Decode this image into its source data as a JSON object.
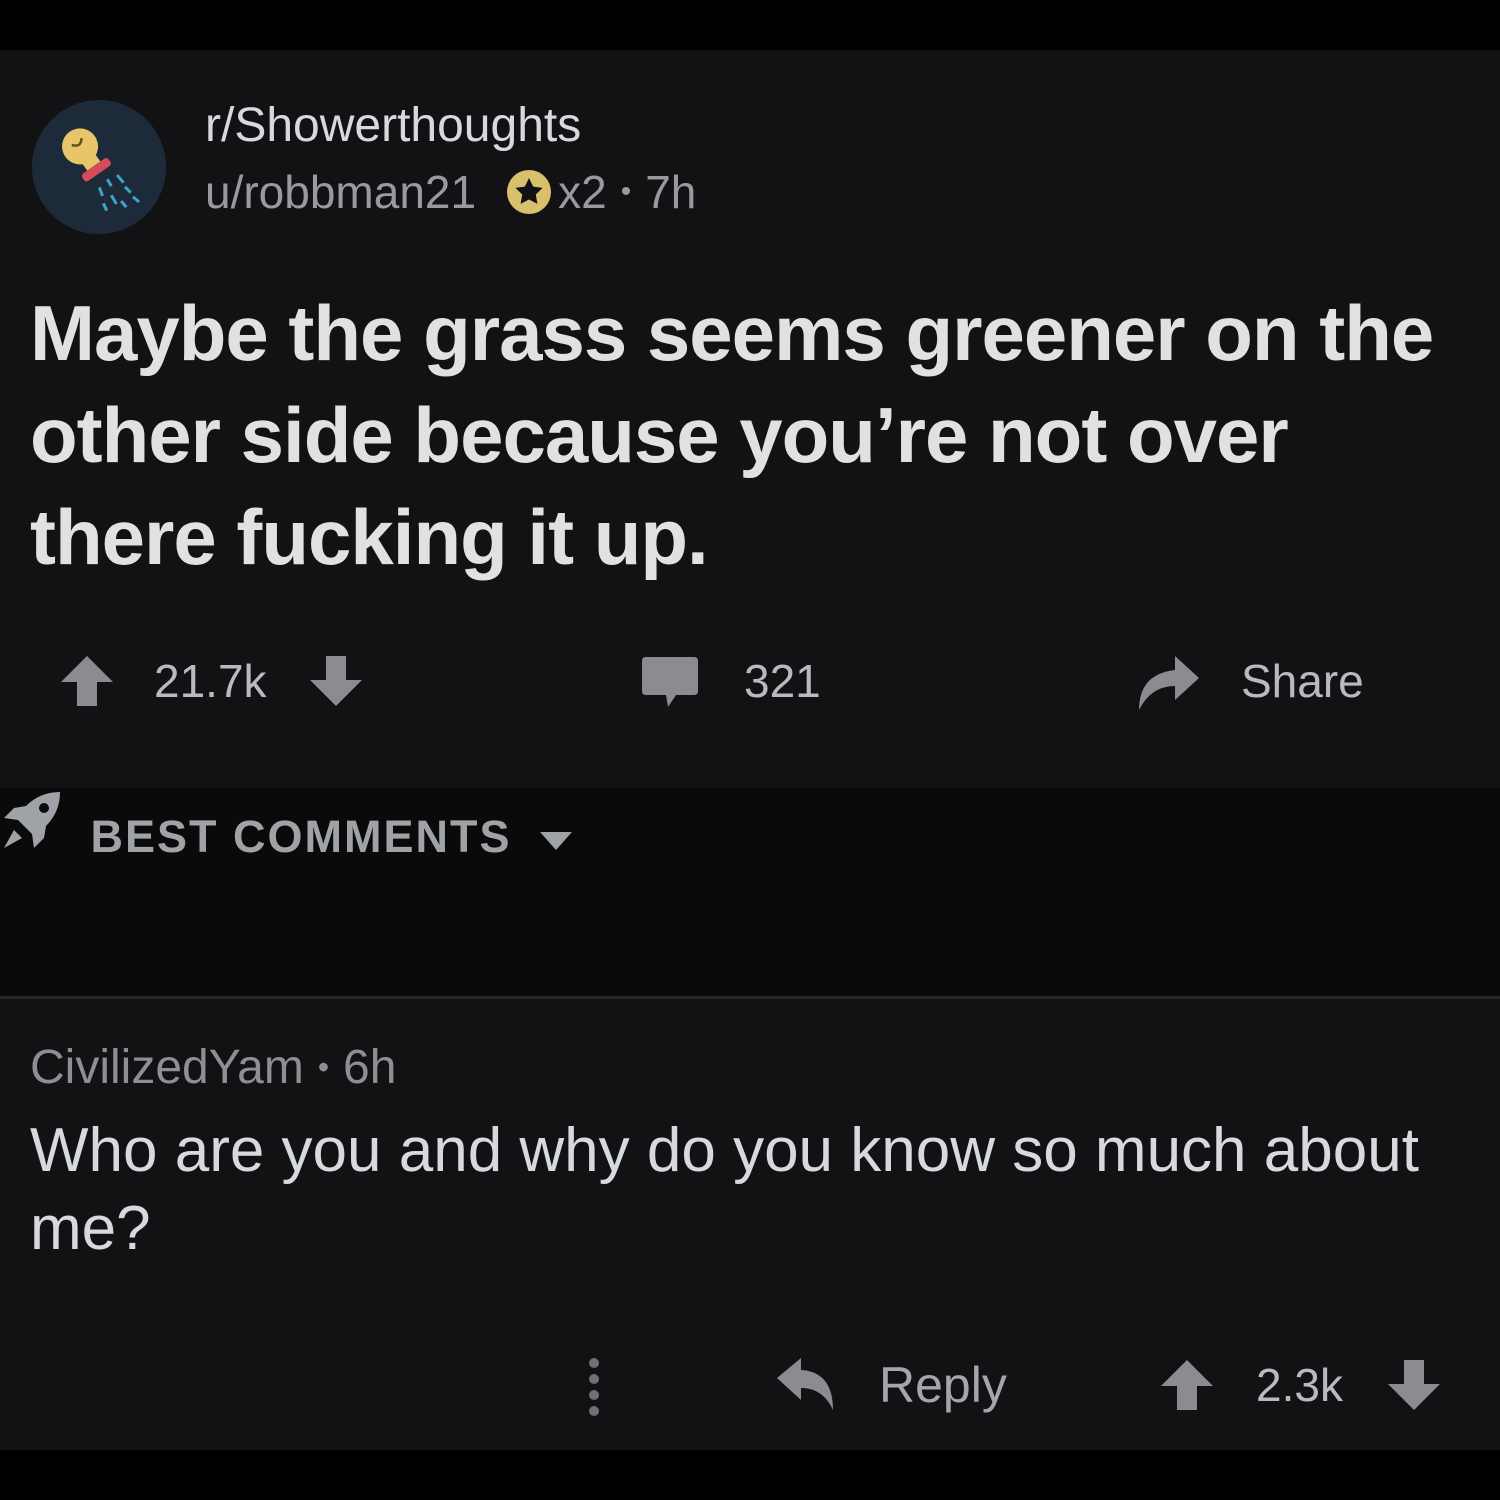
{
  "post": {
    "subreddit": "r/Showerthoughts",
    "author": "u/robbman21",
    "award_count": "x2",
    "time": "7h",
    "title": "Maybe the grass seems greener on the other side because you’re not over there fucking it up.",
    "score": "21.7k",
    "comment_count": "321",
    "share_label": "Share"
  },
  "sort": {
    "label": "BEST COMMENTS"
  },
  "comment": {
    "author": "CivilizedYam",
    "time": "6h",
    "body": "Who are you and why do you know so much about me?",
    "reply_label": "Reply",
    "score": "2.3k"
  },
  "colors": {
    "background": "#121214",
    "sort_bar": "#0a0a0b",
    "text_primary": "#d7dadc",
    "text_meta": "#9a9a9e",
    "award_gold": "#d8c16a"
  },
  "icons": {
    "avatar": "shower-lightbulb-icon",
    "award": "silver-star-award-icon",
    "upvote": "arrow-up-icon",
    "downvote": "arrow-down-icon",
    "comments": "speech-bubble-icon",
    "share": "share-arrow-icon",
    "sort": "rocket-icon",
    "caret": "caret-down-icon",
    "more": "vertical-dots-icon",
    "reply": "reply-arrow-icon"
  }
}
